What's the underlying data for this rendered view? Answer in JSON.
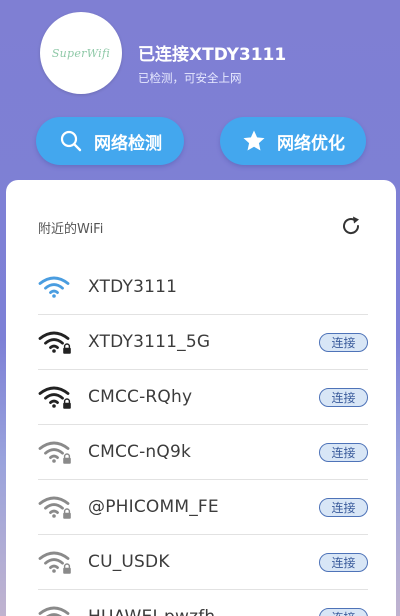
{
  "header": {
    "logo_text": "SuperWifi",
    "connection_title": "已连接XTDY3111",
    "connection_subtitle": "已检测，可安全上网"
  },
  "actions": {
    "detect_label": "网络检测",
    "optimize_label": "网络优化"
  },
  "wifi_list": {
    "label": "附近的WiFi",
    "connect_label": "连接",
    "networks": [
      {
        "ssid": "XTDY3111",
        "connected": true,
        "locked": false,
        "strength": "strong"
      },
      {
        "ssid": "XTDY3111_5G",
        "connected": false,
        "locked": true,
        "strength": "strong"
      },
      {
        "ssid": "CMCC-RQhy",
        "connected": false,
        "locked": true,
        "strength": "strong"
      },
      {
        "ssid": "CMCC-nQ9k",
        "connected": false,
        "locked": true,
        "strength": "weak"
      },
      {
        "ssid": "@PHICOMM_FE",
        "connected": false,
        "locked": true,
        "strength": "weak"
      },
      {
        "ssid": "CU_USDK",
        "connected": false,
        "locked": true,
        "strength": "weak"
      },
      {
        "ssid": "HUAWEI-pwzfh",
        "connected": false,
        "locked": true,
        "strength": "weak"
      }
    ]
  },
  "colors": {
    "background": "#7f7fd3",
    "accent_button": "#43a7ee",
    "wifi_connected": "#4a9de0",
    "wifi_strong": "#222222",
    "wifi_weak": "#8a8a8a"
  }
}
